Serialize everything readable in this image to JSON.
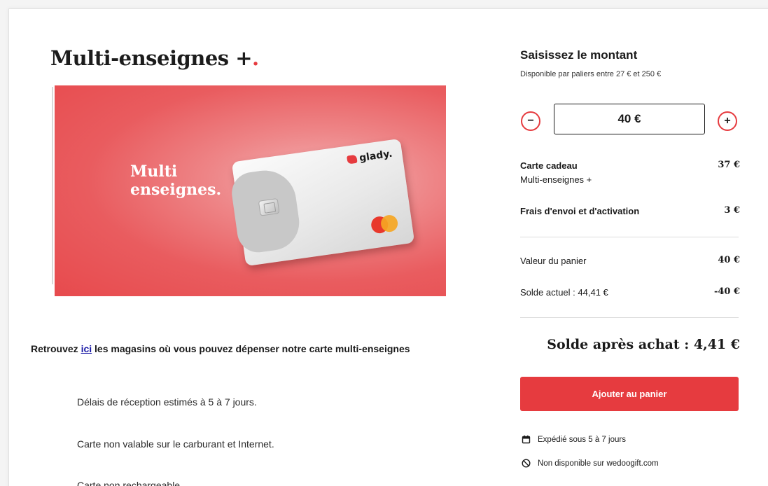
{
  "product": {
    "title": "Multi-enseignes +",
    "title_dot": ".",
    "banner_line1": "Multi",
    "banner_line2": "enseignes.",
    "card_brand": "glady."
  },
  "description": {
    "find_prefix": "Retrouvez ",
    "find_link": "ici",
    "find_suffix": " les magasins où vous pouvez dépenser notre carte multi-enseignes",
    "delay": "Délais de réception estimés à 5 à 7 jours.",
    "not_valid": "Carte non valable sur le carburant et Internet.",
    "cut_line": "Carte non rechargeable."
  },
  "amount": {
    "title": "Saisissez le montant",
    "subtitle": "Disponible par paliers entre 27 € et 250 €",
    "value": "40 €",
    "minus_label": "−",
    "plus_label": "+"
  },
  "summary": {
    "gift_card_label": "Carte cadeau",
    "gift_card_name": "Multi-enseignes +",
    "gift_card_value": "37 €",
    "fees_label": "Frais d'envoi et d'activation",
    "fees_value": "3 €",
    "cart_label": "Valeur du panier",
    "cart_value": "40 €",
    "balance_label": "Solde actuel : 44,41 €",
    "balance_value": "-40 €",
    "after_label": "Solde après achat : 4,41 €"
  },
  "cta": {
    "add_to_cart": "Ajouter au panier"
  },
  "notes": {
    "shipping": "Expédié sous 5 à 7 jours",
    "availability": "Non disponible sur wedoogift.com",
    "shipping_icon": "calendar-icon",
    "availability_icon": "prohibited-icon"
  },
  "colors": {
    "accent": "#e63b3f",
    "link": "#1a1aa6"
  }
}
